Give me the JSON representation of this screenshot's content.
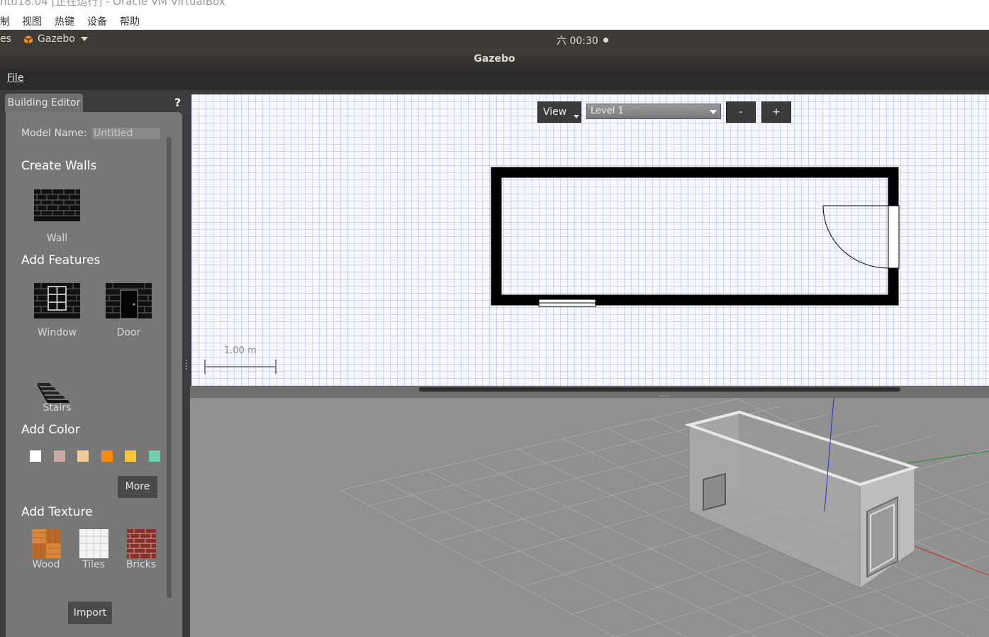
{
  "vbox": {
    "title": "ntu18.04 [正在运行] - Oracle VM VirtualBox",
    "menu": [
      "制",
      "视图",
      "热键",
      "设备",
      "帮助"
    ]
  },
  "top_bar": {
    "activities": "es",
    "app_name": "Gazebo",
    "clock": "六 00:30"
  },
  "window": {
    "title": "Gazebo"
  },
  "menubar": {
    "file": "File"
  },
  "panel": {
    "tab": "Building Editor",
    "help": "?",
    "model_name_label": "Model Name:",
    "model_name_value": "Untitled",
    "create_walls": "Create Walls",
    "wall": "Wall",
    "add_features": "Add Features",
    "window": "Window",
    "door": "Door",
    "stairs": "Stairs",
    "add_color": "Add Color",
    "colors": [
      "#ffffff",
      "#c8a8a0",
      "#f0cc98",
      "#f98b0c",
      "#f8c23a",
      "#6fcfa8"
    ],
    "more": "More",
    "add_texture": "Add Texture",
    "wood": "Wood",
    "tiles": "Tiles",
    "bricks": "Bricks",
    "import": "Import"
  },
  "toolbar2d": {
    "view": "View",
    "level": "Level 1",
    "minus": "-",
    "plus": "+"
  },
  "scale": "1.00 m"
}
